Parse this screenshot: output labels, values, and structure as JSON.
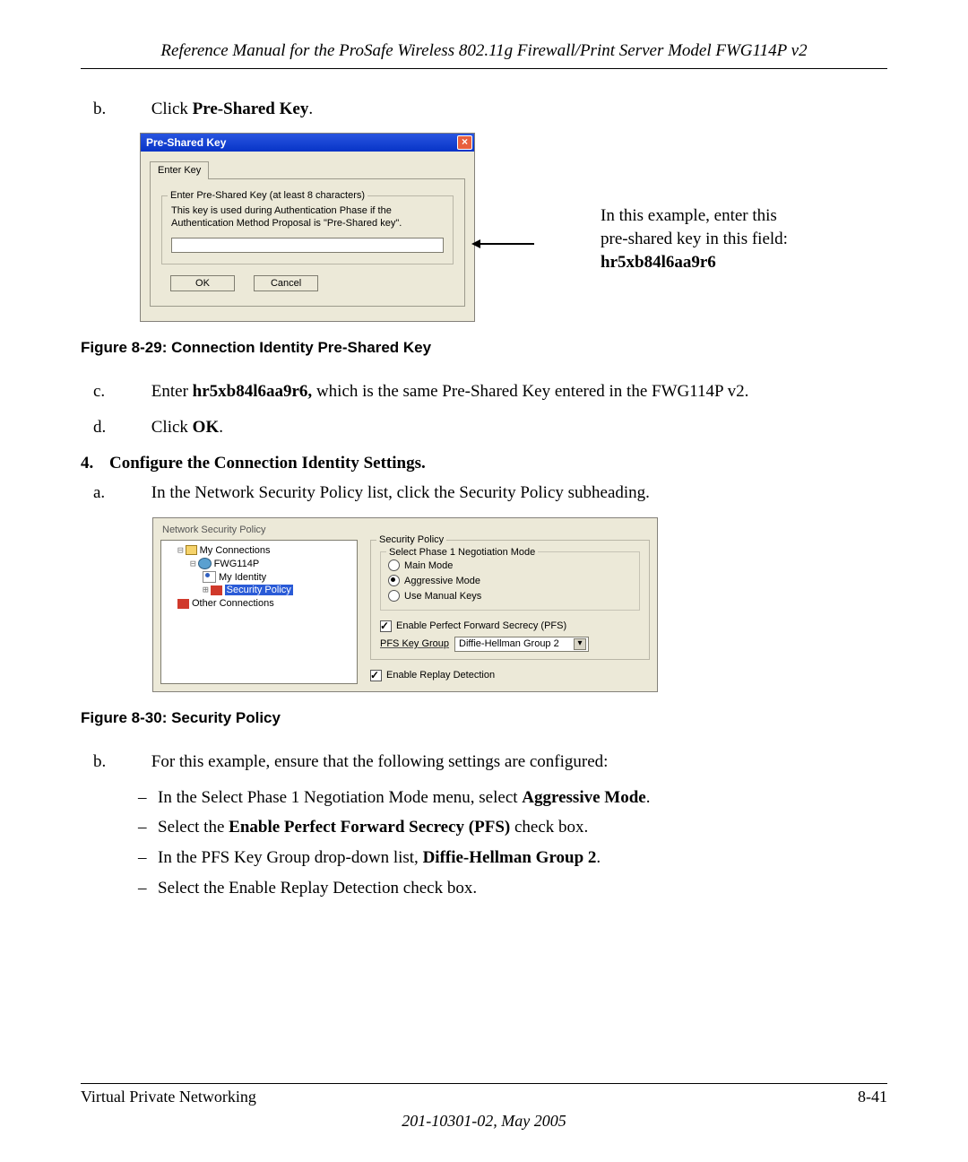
{
  "running_head": "Reference Manual for the ProSafe Wireless 802.11g  Firewall/Print Server Model FWG114P v2",
  "step_b_prefix": "b.",
  "step_b_text_plain": "Click ",
  "step_b_text_bold": "Pre-Shared Key",
  "psk": {
    "title": "Pre-Shared Key",
    "tab": "Enter Key",
    "group_legend": "Enter Pre-Shared Key (at least 8 characters)",
    "note": "This key is used during Authentication Phase if the Authentication Method Proposal is \"Pre-Shared key\".",
    "ok": "OK",
    "cancel": "Cancel"
  },
  "annot_line1": "In this example, enter this",
  "annot_line2": "pre-shared key in this field:",
  "annot_key": "hr5xb84l6aa9r6",
  "fig29_caption": "Figure 8-29:  Connection Identity Pre-Shared Key",
  "step_c_prefix": "c.",
  "step_c_a": "Enter ",
  "step_c_key": "hr5xb84l6aa9r6,",
  "step_c_b": " which is the same Pre-Shared Key entered in the FWG114P v2.",
  "step_d_prefix": "d.",
  "step_d_a": "Click ",
  "step_d_bold": "OK",
  "step4_marker": "4.",
  "step4_title": "Configure the Connection Identity Settings.",
  "step4a_prefix": "a.",
  "step4a_text": "In the Network Security Policy list, click the Security Policy subheading.",
  "sp": {
    "header": "Network Security Policy",
    "tree_root": "My Connections",
    "tree_conn": "FWG114P",
    "tree_id": "My Identity",
    "tree_sel": "Security Policy",
    "tree_other": "Other Connections",
    "grp_legend": "Security Policy",
    "inner_legend": "Select Phase 1 Negotiation Mode",
    "opt_main": "Main Mode",
    "opt_aggr": "Aggressive Mode",
    "opt_manual": "Use Manual Keys",
    "chk_pfs": "Enable Perfect Forward Secrecy (PFS)",
    "pfs_label": "PFS Key Group",
    "pfs_value": "Diffie-Hellman Group 2",
    "chk_replay": "Enable Replay Detection"
  },
  "fig30_caption": "Figure 8-30:  Security Policy",
  "step4b_prefix": "b.",
  "step4b_text": "For this example, ensure that the following settings are configured:",
  "dash1_a": "In the Select Phase 1 Negotiation Mode menu, select ",
  "dash1_b": "Aggressive Mode",
  "dash2_a": "Select the ",
  "dash2_b": "Enable Perfect Forward Secrecy (PFS)",
  "dash2_c": " check box.",
  "dash3_a": "In the PFS Key Group drop-down list, ",
  "dash3_b": "Diffie-Hellman Group 2",
  "dash4": "Select the Enable Replay Detection check box.",
  "footer_left": "Virtual Private Networking",
  "footer_right": "8-41",
  "doc_version": "201-10301-02, May 2005"
}
